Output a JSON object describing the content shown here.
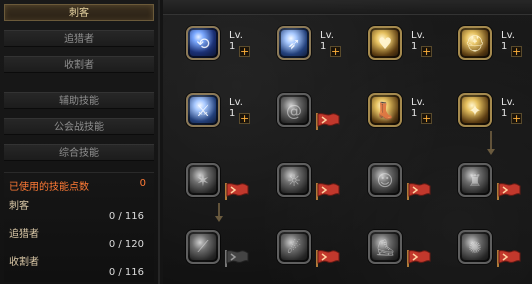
{
  "left_panel": {
    "tabs": [
      {
        "label": "刺客",
        "active": true
      },
      {
        "label": "追猎者"
      },
      {
        "label": "收割者"
      },
      {
        "label": "辅助技能"
      },
      {
        "label": "公会战技能"
      },
      {
        "label": "综合技能"
      }
    ],
    "stats": {
      "used_points_label": "已使用的技能点数",
      "used_points_value": "0",
      "rows": [
        {
          "label": "刺客",
          "value": "0 / 116"
        },
        {
          "label": "追猎者",
          "value": "0 / 120"
        },
        {
          "label": "收割者",
          "value": "0 / 116"
        }
      ]
    }
  },
  "skills": [
    {
      "level": "Lv. 1",
      "plus": "+",
      "variant": "blue",
      "glyph": "swirl-icon"
    },
    {
      "level": "Lv. 1",
      "plus": "+",
      "variant": "blue2",
      "glyph": "dash-icon"
    },
    {
      "level": "Lv. 1",
      "plus": "+",
      "variant": "gold",
      "glyph": "heart-icon"
    },
    {
      "level": "Lv. 1",
      "plus": "+",
      "variant": "gold",
      "glyph": "helmet-icon"
    },
    {
      "level": "Lv. 1",
      "plus": "+",
      "variant": "blue2",
      "glyph": "strike-icon"
    },
    {
      "level": "",
      "plus": "",
      "variant": "locked",
      "glyph": "spiral-icon",
      "flag": true
    },
    {
      "level": "Lv. 1",
      "plus": "+",
      "variant": "gold",
      "glyph": "boot-icon"
    },
    {
      "level": "Lv. 1",
      "plus": "+",
      "variant": "gold",
      "glyph": "wing-icon"
    },
    {
      "level": "",
      "plus": "",
      "variant": "locked",
      "glyph": "shuriken-icon",
      "flag": true
    },
    {
      "level": "",
      "plus": "",
      "variant": "locked",
      "glyph": "beast-icon",
      "flag": true
    },
    {
      "level": "",
      "plus": "",
      "variant": "locked",
      "glyph": "figure-icon",
      "flag": true
    },
    {
      "level": "",
      "plus": "",
      "variant": "locked",
      "glyph": "warrior-icon",
      "flag": true
    },
    {
      "level": "",
      "plus": "",
      "variant": "locked",
      "glyph": "slash-icon",
      "flag": true
    },
    {
      "level": "",
      "plus": "",
      "variant": "locked",
      "glyph": "flame-icon",
      "flag": true
    },
    {
      "level": "",
      "plus": "",
      "variant": "locked",
      "glyph": "boot-icon",
      "flag": true
    },
    {
      "level": "",
      "plus": "",
      "variant": "locked",
      "glyph": "burst-icon",
      "flag": true
    }
  ]
}
